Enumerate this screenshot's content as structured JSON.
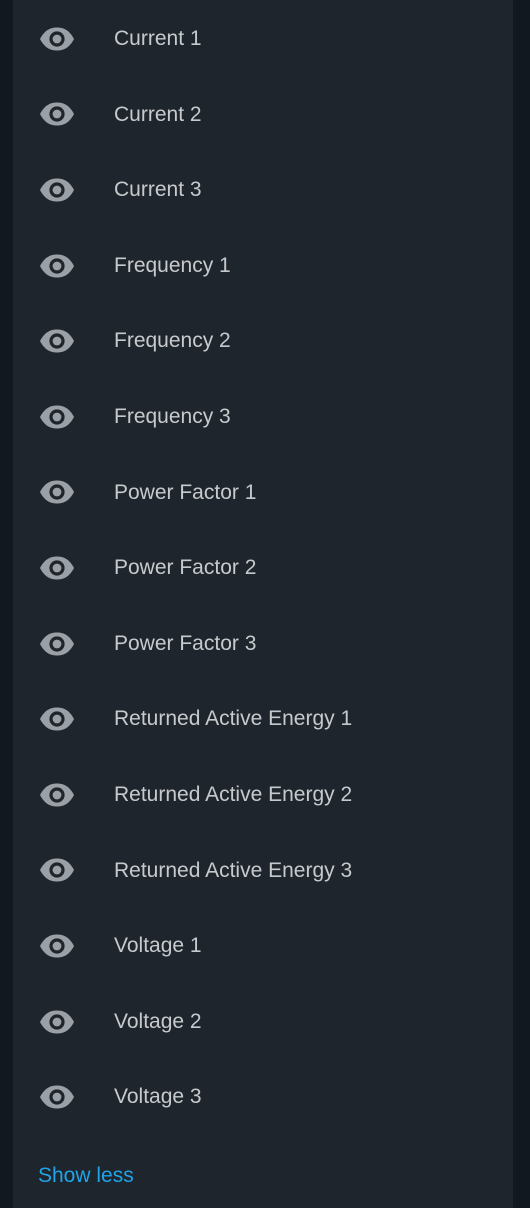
{
  "entities": {
    "items": [
      {
        "label": "Current 1"
      },
      {
        "label": "Current 2"
      },
      {
        "label": "Current 3"
      },
      {
        "label": "Frequency 1"
      },
      {
        "label": "Frequency 2"
      },
      {
        "label": "Frequency 3"
      },
      {
        "label": "Power Factor 1"
      },
      {
        "label": "Power Factor 2"
      },
      {
        "label": "Power Factor 3"
      },
      {
        "label": "Returned Active Energy 1"
      },
      {
        "label": "Returned Active Energy 2"
      },
      {
        "label": "Returned Active Energy 3"
      },
      {
        "label": "Voltage 1"
      },
      {
        "label": "Voltage 2"
      },
      {
        "label": "Voltage 3"
      }
    ],
    "icon": "eye-icon",
    "show_less_label": "Show less"
  },
  "colors": {
    "background": "#111820",
    "card": "#1f252c",
    "text": "#c7cacd",
    "icon": "#9aa0a6",
    "link": "#1ea4e9"
  }
}
